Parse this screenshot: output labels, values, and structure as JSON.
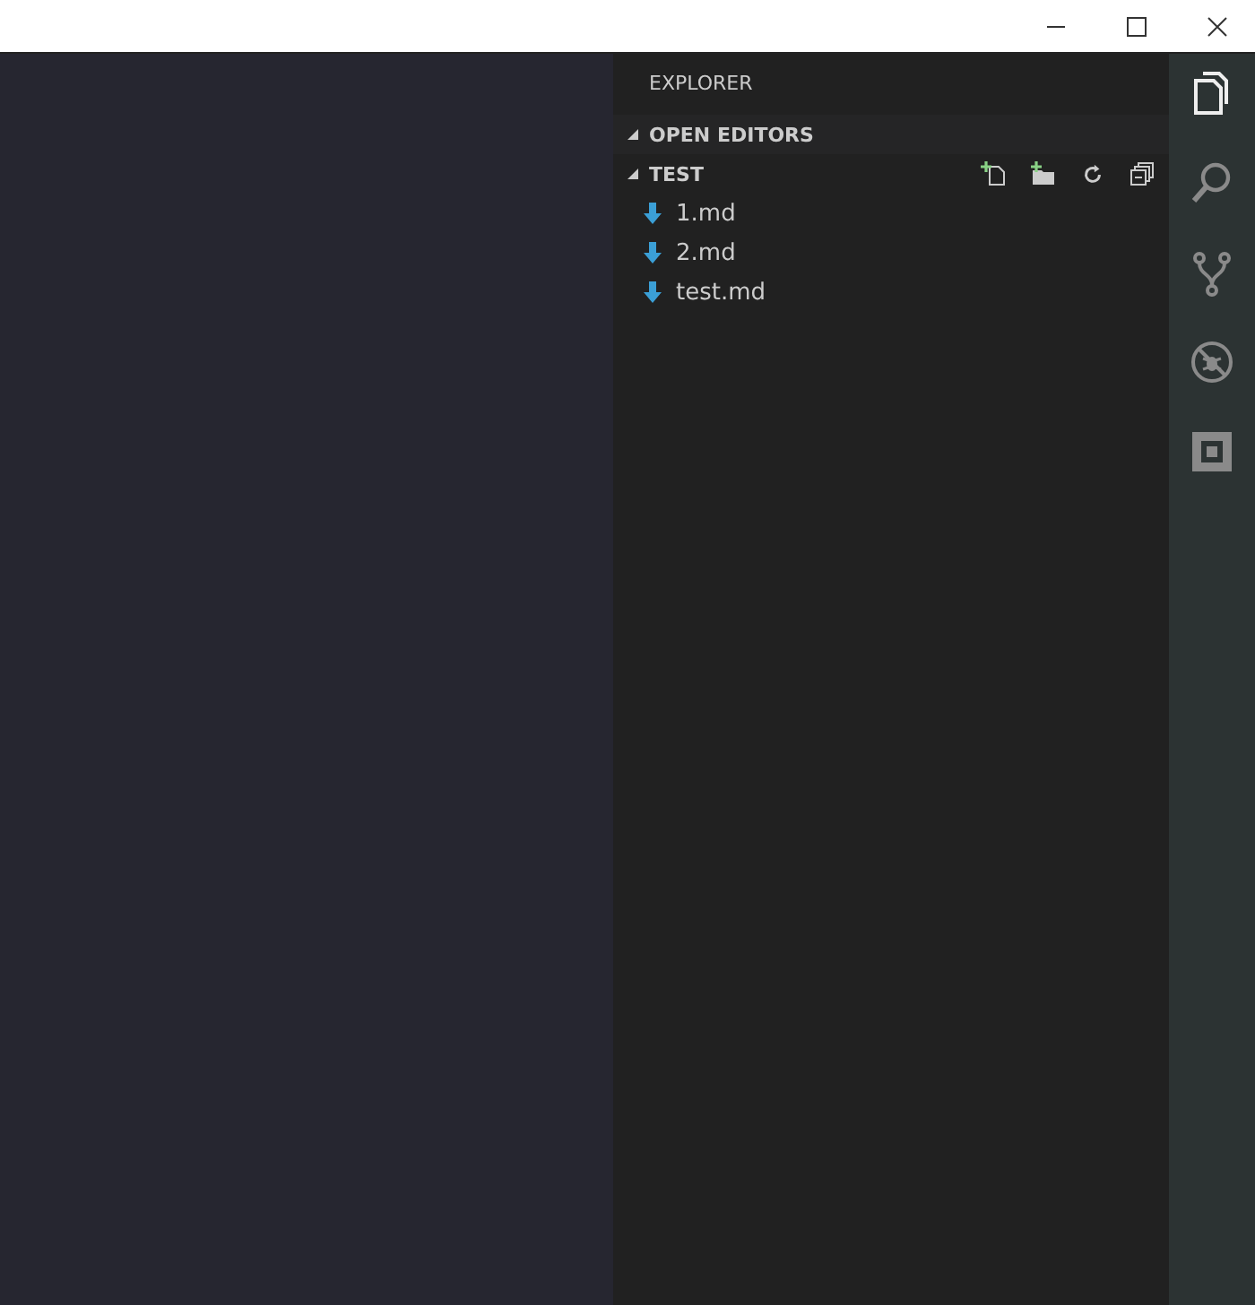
{
  "sidebar": {
    "title": "EXPLORER",
    "sections": [
      {
        "label": "OPEN EDITORS",
        "expanded": true,
        "kind": "editors"
      },
      {
        "label": "TEST",
        "expanded": true,
        "kind": "folder",
        "files": [
          "1.md",
          "2.md",
          "test.md"
        ]
      }
    ]
  },
  "activity_bar": {
    "items": [
      {
        "kind": "explorer",
        "selected": true
      },
      {
        "kind": "search",
        "selected": false
      },
      {
        "kind": "git",
        "selected": false
      },
      {
        "kind": "debug",
        "selected": false
      },
      {
        "kind": "extensions",
        "selected": false
      }
    ]
  }
}
